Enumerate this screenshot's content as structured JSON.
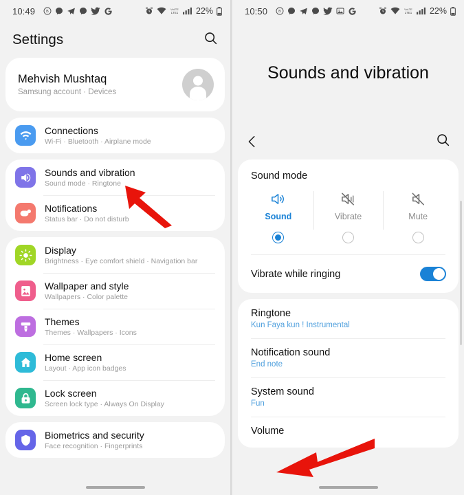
{
  "left": {
    "status_bar": {
      "time": "10:49",
      "left_icons": [
        "badge-b-icon",
        "messenger-icon",
        "telegram-icon",
        "messenger-icon",
        "twitter-icon",
        "google-icon"
      ],
      "right_icons": [
        "alarm-icon",
        "wifi-icon",
        "volte-icon",
        "signal-icon"
      ],
      "battery": "22%"
    },
    "header": {
      "title": "Settings",
      "search_icon": "search-icon"
    },
    "account": {
      "name": "Mehvish Mushtaq",
      "subtitle": "Samsung account  ·  Devices",
      "avatar": "person-avatar"
    },
    "groups": [
      {
        "items": [
          {
            "icon": "wifi-icon",
            "color": "#4a9bf0",
            "title": "Connections",
            "subtitle": "Wi-Fi  ·  Bluetooth  ·  Airplane mode"
          }
        ]
      },
      {
        "items": [
          {
            "icon": "speaker-icon",
            "color": "#7f74e8",
            "title": "Sounds and vibration",
            "subtitle": "Sound mode  ·  Ringtone"
          },
          {
            "icon": "notification-icon",
            "color": "#f4796e",
            "title": "Notifications",
            "subtitle": "Status bar  ·  Do not disturb"
          }
        ]
      },
      {
        "items": [
          {
            "icon": "brightness-icon",
            "color": "#a0d626",
            "title": "Display",
            "subtitle": "Brightness  ·  Eye comfort shield  ·  Navigation bar"
          },
          {
            "icon": "image-icon",
            "color": "#ef5e8c",
            "title": "Wallpaper and style",
            "subtitle": "Wallpapers  ·  Color palette"
          },
          {
            "icon": "brush-icon",
            "color": "#bd6ee0",
            "title": "Themes",
            "subtitle": "Themes  ·  Wallpapers  ·  Icons"
          },
          {
            "icon": "home-icon",
            "color": "#2ebbd8",
            "title": "Home screen",
            "subtitle": "Layout  ·  App icon badges"
          },
          {
            "icon": "lock-icon",
            "color": "#2fb88f",
            "title": "Lock screen",
            "subtitle": "Screen lock type  ·  Always On Display"
          }
        ]
      },
      {
        "items": [
          {
            "icon": "shield-icon",
            "color": "#6565e8",
            "title": "Biometrics and security",
            "subtitle": "Face recognition  ·  Fingerprints"
          }
        ]
      }
    ],
    "annotation_arrow": "red-arrow-pointing-to-sounds-and-vibration"
  },
  "right": {
    "status_bar": {
      "time": "10:50",
      "left_icons": [
        "badge-b-icon",
        "messenger-icon",
        "telegram-icon",
        "messenger-icon",
        "twitter-icon",
        "photos-icon",
        "google-icon"
      ],
      "right_icons": [
        "alarm-icon",
        "wifi-icon",
        "volte-icon",
        "signal-icon"
      ],
      "battery": "22%"
    },
    "page_title": "Sounds and vibration",
    "back_icon": "back-chevron-icon",
    "search_icon": "search-icon",
    "sound_mode": {
      "label": "Sound mode",
      "accent": "#1a82d6",
      "options": [
        {
          "icon": "volume-on-icon",
          "label": "Sound",
          "selected": true
        },
        {
          "icon": "vibrate-icon",
          "label": "Vibrate",
          "selected": false
        },
        {
          "icon": "mute-icon",
          "label": "Mute",
          "selected": false
        }
      ]
    },
    "vibrate_while_ringing": {
      "label": "Vibrate while ringing",
      "enabled": true
    },
    "sound_items": [
      {
        "title": "Ringtone",
        "value": "Kun Faya kun ! Instrumental"
      },
      {
        "title": "Notification sound",
        "value": "End note"
      },
      {
        "title": "System sound",
        "value": "Fun"
      },
      {
        "title": "Volume",
        "value": ""
      }
    ],
    "annotation_arrow": "red-arrow-pointing-to-volume"
  }
}
